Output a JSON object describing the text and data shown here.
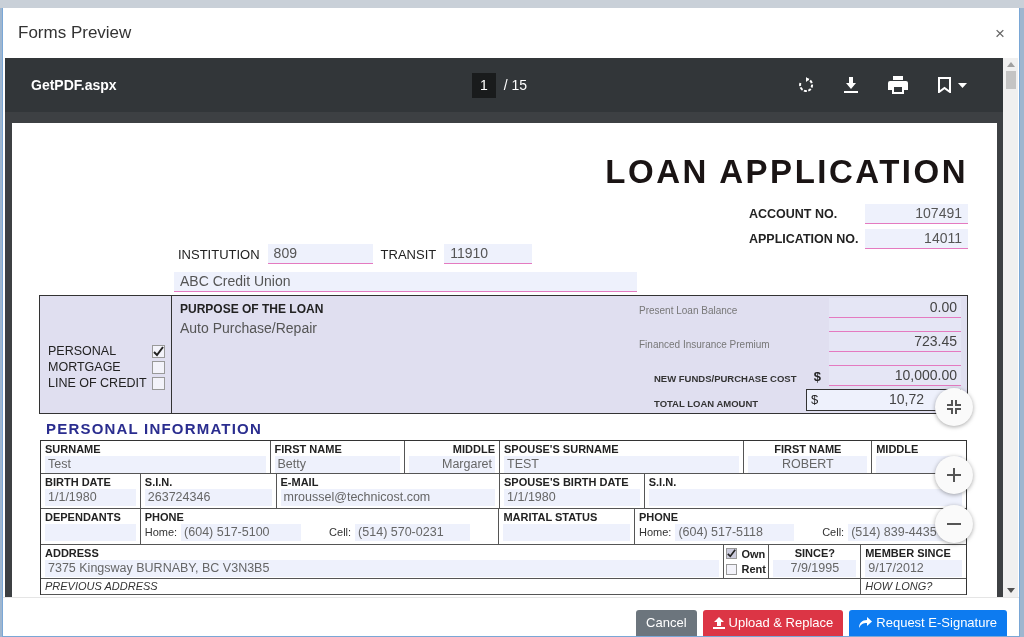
{
  "window": {
    "title": "Forms Preview",
    "close": "×"
  },
  "viewer": {
    "filename": "GetPDF.aspx",
    "page": "1",
    "page_total": "/ 15"
  },
  "document": {
    "title": "LOAN APPLICATION",
    "numbers": [
      {
        "label": "ACCOUNT NO.",
        "value": "107491"
      },
      {
        "label": "APPLICATION NO.",
        "value": "14011"
      }
    ],
    "institution": {
      "label": "INSTITUTION",
      "value": "809"
    },
    "transit": {
      "label": "TRANSIT",
      "value": "11910"
    },
    "institution_name": "ABC Credit Union",
    "loan_types": [
      {
        "label": "PERSONAL",
        "checked": true
      },
      {
        "label": "MORTGAGE",
        "checked": false
      },
      {
        "label": "LINE OF CREDIT",
        "checked": false
      }
    ],
    "purpose": {
      "label": "PURPOSE OF THE LOAN",
      "value": "Auto Purchase/Repair"
    },
    "amounts": [
      {
        "kind": "minor",
        "label": "Present Loan Balance",
        "value": "0.00"
      },
      {
        "kind": "minor",
        "label": "Financed Insurance Premium",
        "value": "723.45"
      },
      {
        "kind": "major",
        "label": "NEW FUNDS/PURCHASE COST",
        "currency": "$",
        "value": "10,000.00"
      },
      {
        "kind": "total",
        "label": "TOTAL LOAN AMOUNT",
        "currency": "$",
        "value": "10,72"
      }
    ],
    "section_title": "PERSONAL INFORMATION",
    "form_lines": [
      {
        "fields": [
          {
            "kind": "field",
            "label": "SURNAME",
            "value": "Test"
          },
          {
            "kind": "field",
            "label": "FIRST NAME",
            "value": "Betty"
          },
          {
            "kind": "field",
            "label": "MIDDLE",
            "value": "Margaret"
          },
          {
            "kind": "field",
            "label": "SPOUSE'S SURNAME",
            "value": "TEST"
          },
          {
            "kind": "field",
            "label": "FIRST NAME",
            "value": "ROBERT"
          },
          {
            "kind": "field",
            "label": "MIDDLE"
          }
        ]
      },
      {
        "fields": [
          {
            "kind": "field",
            "label": "BIRTH DATE",
            "value": "1/1/1980"
          },
          {
            "kind": "field",
            "label": "S.I.N.",
            "value": "263724346"
          },
          {
            "kind": "field",
            "label": "E-MAIL",
            "value": "mroussel@technicost.com"
          },
          {
            "kind": "field",
            "label": "SPOUSE'S BIRTH DATE",
            "value": "1/1/1980"
          },
          {
            "kind": "field",
            "label": "S.I.N."
          }
        ]
      },
      {
        "fields": [
          {
            "kind": "field",
            "label": "DEPENDANTS"
          },
          {
            "kind": "phone",
            "label": "PHONE",
            "home_label": "Home:",
            "home": "(604) 517-5100",
            "cell_label": "Cell:",
            "cell": "(514) 570-0231"
          },
          {
            "kind": "field",
            "label": "MARITAL  STATUS"
          },
          {
            "kind": "phone",
            "label": "PHONE",
            "home_label": "Home:",
            "home": "(604) 517-5118",
            "cell_label": "Cell:",
            "cell": "(514) 839-4435"
          }
        ]
      },
      {
        "fields": [
          {
            "kind": "field",
            "label": "ADDRESS",
            "value": "7375 Kingsway BURNABY, BC V3N3B5"
          },
          {
            "kind": "tenure",
            "options": [
              {
                "label": "Own",
                "checked": true
              },
              {
                "label": "Rent",
                "checked": false
              }
            ]
          },
          {
            "kind": "field",
            "label": "SINCE?",
            "value": "7/9/1995"
          },
          {
            "kind": "field",
            "label": "MEMBER SINCE",
            "value": "9/17/2012"
          }
        ]
      },
      {
        "fields": [
          {
            "kind": "note",
            "label": "PREVIOUS ADDRESS"
          },
          {
            "kind": "note",
            "label": "HOW LONG?"
          }
        ]
      }
    ]
  },
  "buttons": [
    {
      "kind": "cancel",
      "label": "Cancel"
    },
    {
      "kind": "upload",
      "label": "Upload & Replace"
    },
    {
      "kind": "signature",
      "label": "Request E-Signature"
    }
  ]
}
